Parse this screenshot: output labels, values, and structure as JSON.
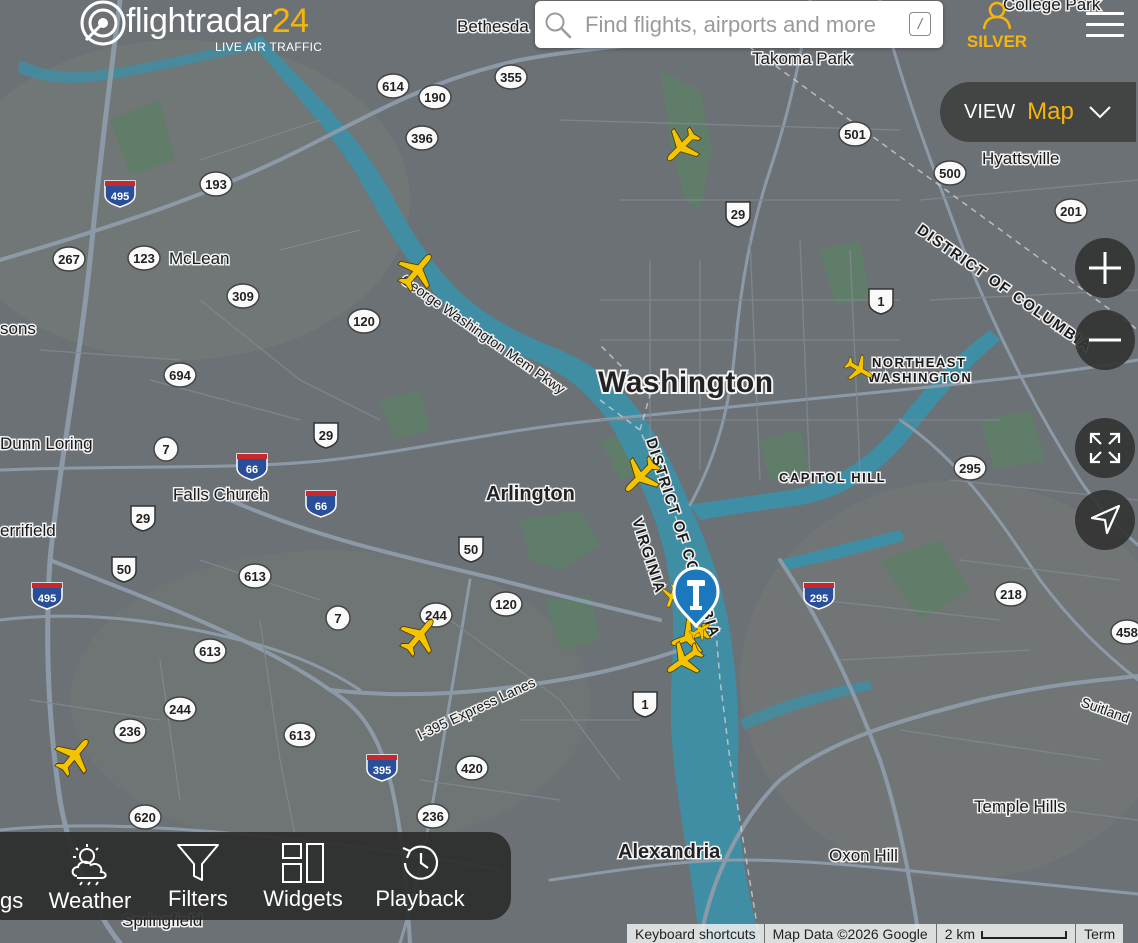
{
  "brand": {
    "name_part1": "flightradar",
    "name_part2": "24",
    "tagline": "LIVE AIR TRAFFIC"
  },
  "search": {
    "placeholder": "Find flights, airports and more",
    "shortcut": "/"
  },
  "user": {
    "label": "SILVER"
  },
  "view": {
    "label": "VIEW",
    "value": "Map"
  },
  "bottom_bar": {
    "partial_label": "gs",
    "items": [
      {
        "label": "Weather",
        "icon": "weather-icon"
      },
      {
        "label": "Filters",
        "icon": "filter-icon"
      },
      {
        "label": "Widgets",
        "icon": "widgets-icon"
      },
      {
        "label": "Playback",
        "icon": "playback-icon"
      }
    ]
  },
  "attribution": {
    "shortcuts": "Keyboard shortcuts",
    "map_data": "Map Data ©2026 Google",
    "scale": "2 km",
    "terms": "Term"
  },
  "map": {
    "places": {
      "washington": "Washington",
      "arlington": "Arlington",
      "alexandria": "Alexandria",
      "mclean": "McLean",
      "falls_church": "Falls Church",
      "dunn_loring": "Dunn Loring",
      "merrifield": "errifield",
      "sons": "sons",
      "bethesda": "Bethesda",
      "takoma_park": "Takoma Park",
      "hyattsville": "Hyattsville",
      "college_park": "College Park",
      "temple_hills": "Temple Hills",
      "oxon_hill": "Oxon Hill",
      "springfield": "Springfield",
      "suitland": "Suitland",
      "capitol_hill": "CAPITOL HILL",
      "ne_washington_1": "NORTHEAST",
      "ne_washington_2": "WASHINGTON",
      "district_of_columbia": "DISTRICT OF COLUMBIA",
      "dc_vertical": "DISTRICT OF COLUMBIA",
      "virginia": "VIRGINIA",
      "gw_parkway": "George Washington Mem Pkwy",
      "i395_express": "I-395 Express Lanes"
    },
    "shields": [
      {
        "text": "614",
        "kind": "state"
      },
      {
        "text": "190",
        "kind": "state"
      },
      {
        "text": "355",
        "kind": "state"
      },
      {
        "text": "396",
        "kind": "state"
      },
      {
        "text": "495",
        "kind": "interstate"
      },
      {
        "text": "193",
        "kind": "state"
      },
      {
        "text": "267",
        "kind": "state"
      },
      {
        "text": "123",
        "kind": "state"
      },
      {
        "text": "309",
        "kind": "state"
      },
      {
        "text": "120",
        "kind": "state"
      },
      {
        "text": "694",
        "kind": "state"
      },
      {
        "text": "7",
        "kind": "state"
      },
      {
        "text": "66",
        "kind": "interstate"
      },
      {
        "text": "29",
        "kind": "us"
      },
      {
        "text": "66",
        "kind": "interstate"
      },
      {
        "text": "29",
        "kind": "us"
      },
      {
        "text": "50",
        "kind": "us"
      },
      {
        "text": "50",
        "kind": "us"
      },
      {
        "text": "495",
        "kind": "interstate"
      },
      {
        "text": "613",
        "kind": "state"
      },
      {
        "text": "7",
        "kind": "state"
      },
      {
        "text": "244",
        "kind": "state"
      },
      {
        "text": "120",
        "kind": "state"
      },
      {
        "text": "613",
        "kind": "state"
      },
      {
        "text": "244",
        "kind": "state"
      },
      {
        "text": "236",
        "kind": "state"
      },
      {
        "text": "613",
        "kind": "state"
      },
      {
        "text": "395",
        "kind": "interstate"
      },
      {
        "text": "420",
        "kind": "state"
      },
      {
        "text": "620",
        "kind": "state"
      },
      {
        "text": "236",
        "kind": "state"
      },
      {
        "text": "1",
        "kind": "us"
      },
      {
        "text": "501",
        "kind": "state"
      },
      {
        "text": "500",
        "kind": "state"
      },
      {
        "text": "29",
        "kind": "us"
      },
      {
        "text": "201",
        "kind": "state"
      },
      {
        "text": "1",
        "kind": "us"
      },
      {
        "text": "295",
        "kind": "state"
      },
      {
        "text": "295",
        "kind": "interstate"
      },
      {
        "text": "218",
        "kind": "state"
      },
      {
        "text": "458",
        "kind": "state"
      }
    ],
    "colors": {
      "aircraft": "#f5c400",
      "accent": "#f5b50a",
      "water": "#3e8fa6",
      "park": "#5b8f6a"
    },
    "aircraft_count": 10,
    "airport_marker": "airport-marker-icon"
  }
}
